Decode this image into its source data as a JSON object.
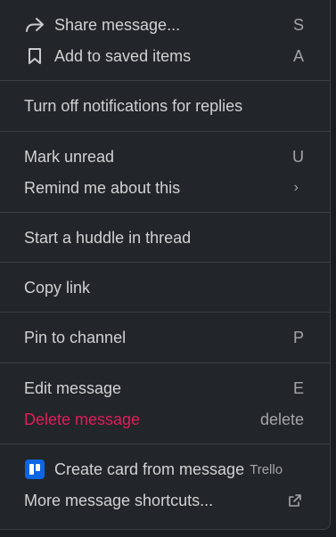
{
  "menu": {
    "share": {
      "label": "Share message...",
      "shortcut": "S",
      "icon": "share-arrow-icon"
    },
    "save": {
      "label": "Add to saved items",
      "shortcut": "A",
      "icon": "bookmark-icon"
    },
    "notifications": {
      "label": "Turn off notifications for replies"
    },
    "mark_unread": {
      "label": "Mark unread",
      "shortcut": "U"
    },
    "remind": {
      "label": "Remind me about this",
      "chevron": "›"
    },
    "huddle": {
      "label": "Start a huddle in thread"
    },
    "copy_link": {
      "label": "Copy link"
    },
    "pin": {
      "label": "Pin to channel",
      "shortcut": "P"
    },
    "edit": {
      "label": "Edit message",
      "shortcut": "E"
    },
    "delete": {
      "label": "Delete message",
      "shortcut": "delete",
      "color": "#e01e5a"
    },
    "trello": {
      "label": "Create card from message",
      "source": "Trello",
      "icon": "trello-icon",
      "brand_color": "#0c66e4"
    },
    "more": {
      "label": "More message shortcuts...",
      "icon": "external-link-icon"
    }
  }
}
